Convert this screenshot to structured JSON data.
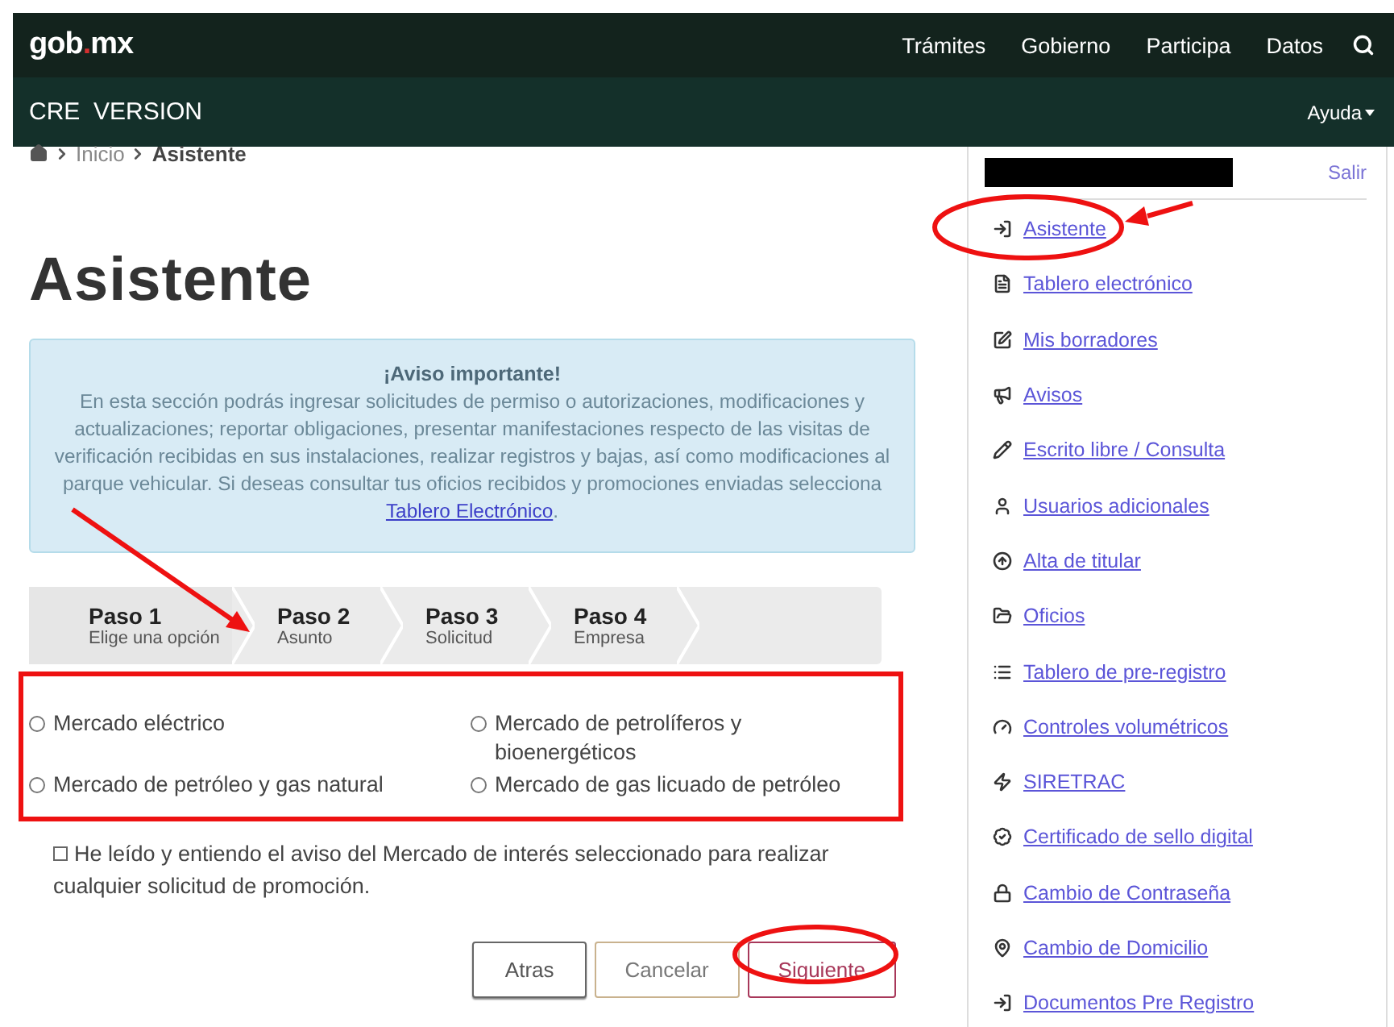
{
  "header": {
    "logo_main": "gob",
    "logo_dot": ".",
    "logo_end": "mx",
    "nav": [
      "Trámites",
      "Gobierno",
      "Participa",
      "Datos"
    ]
  },
  "subheader": {
    "title": "CRE  VERSION",
    "menu": "Ayuda"
  },
  "breadcrumb": [
    "Inicio",
    "Asistente"
  ],
  "heading": "Asistente",
  "notice": {
    "title": "¡Aviso importante!",
    "text": "En esta sección podrás ingresar solicitudes de permiso o autorizaciones, modificaciones y actualizaciones; reportar obligaciones, presentar manifestaciones respecto de las visitas de verificación recibidas en sus instalaciones, realizar registros y bajas, así como modificaciones al parque vehicular. Si deseas consultar tus oficios recibidos y promociones enviadas selecciona",
    "link": "Tablero Electrónico",
    "end": "."
  },
  "steps": [
    {
      "title": "Paso 1",
      "subtitle": "Elige una opción",
      "selected": true
    },
    {
      "title": "Paso 2",
      "subtitle": "Asunto",
      "selected": false
    },
    {
      "title": "Paso 3",
      "subtitle": "Solicitud",
      "selected": false
    },
    {
      "title": "Paso 4",
      "subtitle": "Empresa",
      "selected": false
    }
  ],
  "options": [
    {
      "label": "Mercado eléctrico",
      "selected": false
    },
    {
      "label": "Mercado de petrolíferos y bioenergéticos",
      "selected": false
    },
    {
      "label": "Mercado de petróleo y gas natural",
      "selected": false
    },
    {
      "label": "Mercado de gas licuado de petróleo",
      "selected": false
    }
  ],
  "agreement": {
    "label": "He leído y entiendo el aviso del Mercado de interés seleccionado para realizar cualquier solicitud de promoción.",
    "checked": false
  },
  "buttons": [
    "Atras",
    "Cancelar",
    "Siguiente"
  ],
  "sidebar": {
    "logout": "Salir",
    "items": [
      "Asistente",
      "Tablero electrónico",
      "Mis borradores",
      "Avisos",
      "Escrito libre / Consulta",
      "Usuarios adicionales",
      "Alta de titular",
      "Oficios",
      "Tablero de pre-registro",
      "Controles volumétricos",
      "SIRETRAC",
      "Certificado de sello digital",
      "Cambio de Contraseña",
      "Cambio de Domicilio",
      "Documentos Pre Registro"
    ]
  }
}
